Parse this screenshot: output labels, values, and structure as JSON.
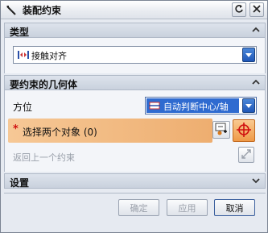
{
  "window": {
    "title": "装配约束",
    "title_icon": "wrench-icon",
    "reset_icon": "reset-icon",
    "close_icon": "close-icon"
  },
  "type_section": {
    "header": "类型",
    "dropdown_value": "接触对齐",
    "dropdown_icon": "touch-align-icon"
  },
  "geometry_section": {
    "header": "要约束的几何体",
    "orientation_label": "方位",
    "orientation_value": "自动判断中心/轴",
    "select_prompt": "选择两个对象 (0)",
    "required_marker": "*",
    "return_label": "返回上一个约束"
  },
  "settings_section": {
    "header": "设置"
  },
  "buttons": {
    "ok": "确定",
    "apply": "应用",
    "cancel": "取消"
  },
  "colors": {
    "accent_orange": "#f0b274",
    "highlight_blue": "#2f6bd0",
    "required_red": "#d01010"
  }
}
